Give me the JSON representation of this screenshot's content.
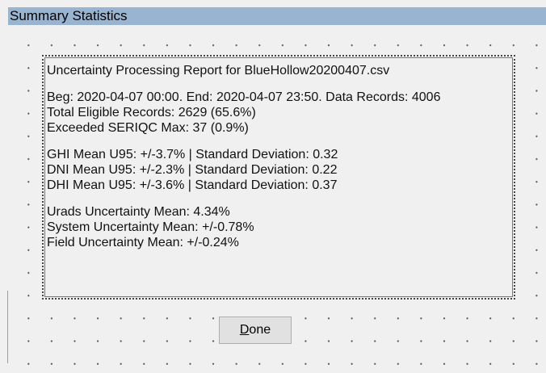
{
  "window": {
    "title": "Summary Statistics"
  },
  "report": {
    "title": "Uncertainty Processing Report for BlueHollow20200407.csv",
    "lines": [
      "Beg: 2020-04-07 00:00. End: 2020-04-07 23:50. Data Records: 4006",
      "Total Eligible Records: 2629 (65.6%)",
      "Exceeded SERIQC Max: 37 (0.9%)",
      "GHI Mean U95: +/-3.7% | Standard Deviation: 0.32",
      "DNI Mean U95: +/-2.3% | Standard Deviation: 0.22",
      "DHI Mean U95: +/-3.6% | Standard Deviation: 0.37",
      "Urads Uncertainty Mean: 4.34%",
      "System Uncertainty Mean: +/-0.78%",
      "Field Uncertainty Mean: +/-0.24%"
    ]
  },
  "done_button": {
    "mnemonic": "D",
    "rest": "one"
  }
}
